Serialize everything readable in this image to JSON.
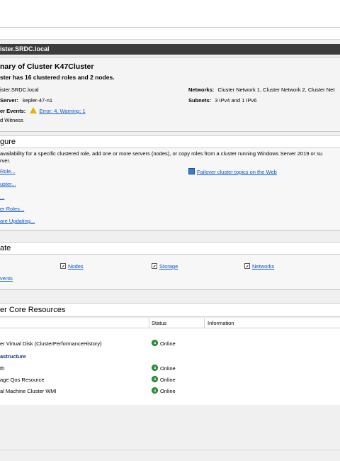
{
  "header": {
    "title": "ister.SRDC.local"
  },
  "summary": {
    "heading": "nary of Cluster K47Cluster",
    "subheading": "ster has 16 clustered roles and 2 nodes.",
    "name_value": "ister.SRDC.local",
    "server_label": "Server:",
    "server_value": "kepler-47-n1",
    "events_label": "er Events:",
    "events_link": "Error: 4, Warning: 1",
    "witness": "d Witness",
    "networks_label": "Networks:",
    "networks_value": "Cluster Network 1, Cluster Network 2, Cluster Net",
    "subnets_label": "Subnets:",
    "subnets_value": "3 IPv4 and 1 IPv6"
  },
  "configure": {
    "title": "gure",
    "desc_line1": "availability for a specific clustered role, add one or more servers (nodes), or copy roles from a cluster running Windows Server 2019 or su",
    "desc_line2": "rver.",
    "links": [
      "Role...",
      "uster...",
      "...",
      "er Roles...",
      "are Updating..."
    ],
    "help_link": "Failover cluster topics on the Web"
  },
  "navigate": {
    "title": "ate",
    "nodes": "Nodes",
    "storage": "Storage",
    "networks": "Networks",
    "events": "vents"
  },
  "core": {
    "title": "er Core Resources",
    "columns": {
      "status": "Status",
      "information": "Information"
    },
    "rows": [
      {
        "name": "er Virtual Disk (ClusterPerformanceHistory)",
        "status": "Online"
      },
      {
        "name": "astructure",
        "group": true
      },
      {
        "name": "th",
        "status": "Online"
      },
      {
        "name": "age Qos Resource",
        "status": "Online"
      },
      {
        "name": "al Machine Cluster WMI",
        "status": "Online"
      }
    ]
  }
}
